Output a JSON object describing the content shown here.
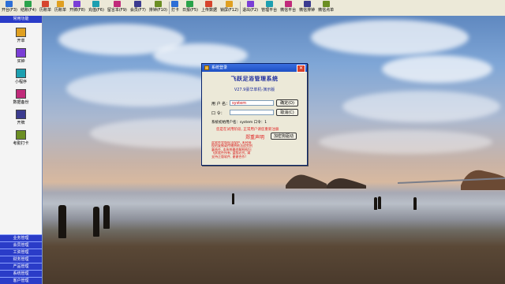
{
  "toolbar": {
    "items": [
      {
        "label": "开台(F3)",
        "icon": "open-table-icon"
      },
      {
        "label": "结账(F4)",
        "icon": "checkout-icon"
      },
      {
        "label": "历账单",
        "icon": "history-bill-icon"
      },
      {
        "label": "历账单",
        "icon": "history-bill2-icon"
      },
      {
        "label": "开牌(F8)",
        "icon": "card-icon"
      },
      {
        "label": "充值(F6)",
        "icon": "recharge-icon"
      },
      {
        "label": "留言本(F9)",
        "icon": "message-icon"
      },
      {
        "label": "会员(F7)",
        "icon": "member-icon"
      },
      {
        "label": "排钟(F10)",
        "icon": "clock-icon"
      },
      {
        "label": "打卡",
        "icon": "punch-icon"
      },
      {
        "label": "日报(F5)",
        "icon": "report-icon"
      },
      {
        "label": "上传数据",
        "icon": "upload-icon"
      },
      {
        "label": "锁屏(F12)",
        "icon": "lock-icon"
      },
      {
        "label": "退出(F2)",
        "icon": "exit-icon"
      },
      {
        "label": "管理平台",
        "icon": "admin-icon"
      },
      {
        "label": "微信平台",
        "icon": "wechat-icon"
      },
      {
        "label": "微信排钟",
        "icon": "wechat-clock-icon"
      },
      {
        "label": "微信点单",
        "icon": "wechat-order-icon"
      }
    ]
  },
  "sidebar": {
    "header": "常用功能",
    "items": [
      {
        "label": "开单",
        "icon": "open-order-icon"
      },
      {
        "label": "买钟",
        "icon": "buy-clock-icon"
      },
      {
        "label": "小程序",
        "icon": "miniprogram-icon"
      },
      {
        "label": "数据备份",
        "icon": "backup-icon"
      },
      {
        "label": "开牌",
        "icon": "open-card-icon"
      },
      {
        "label": "考勤打卡",
        "icon": "attendance-icon"
      }
    ],
    "tabs": [
      "业务管理",
      "会员管理",
      "工资管理",
      "财务管理",
      "产品管理",
      "系统管理",
      "客户管理"
    ]
  },
  "dialog": {
    "title": "系统登录",
    "brand": "飞跃足浴管理系统",
    "version": "V27.9豪华单机-演示版",
    "user_label": "用 户 名：",
    "user_value": "system",
    "password_label": "口     令：",
    "password_value": "",
    "login_button": "确定(O)",
    "cancel_button": "取消(C)",
    "default_hint": "系统初始用户名：system  口令：1",
    "demo_hint": "您是在试用阶段, 正常用户请您重新注册",
    "notice_title": "郑重声明",
    "demo_button": "加密狗驱动",
    "notice_lines": [
      "此软件受版权法保护, 未经授",
      "权的复制或传播将依法追究刑",
      "事责任, 本系统最终解释权归",
      "飞跃软件所有, 盗版必究, 请",
      "支持正版软件, 谢谢合作!"
    ]
  }
}
